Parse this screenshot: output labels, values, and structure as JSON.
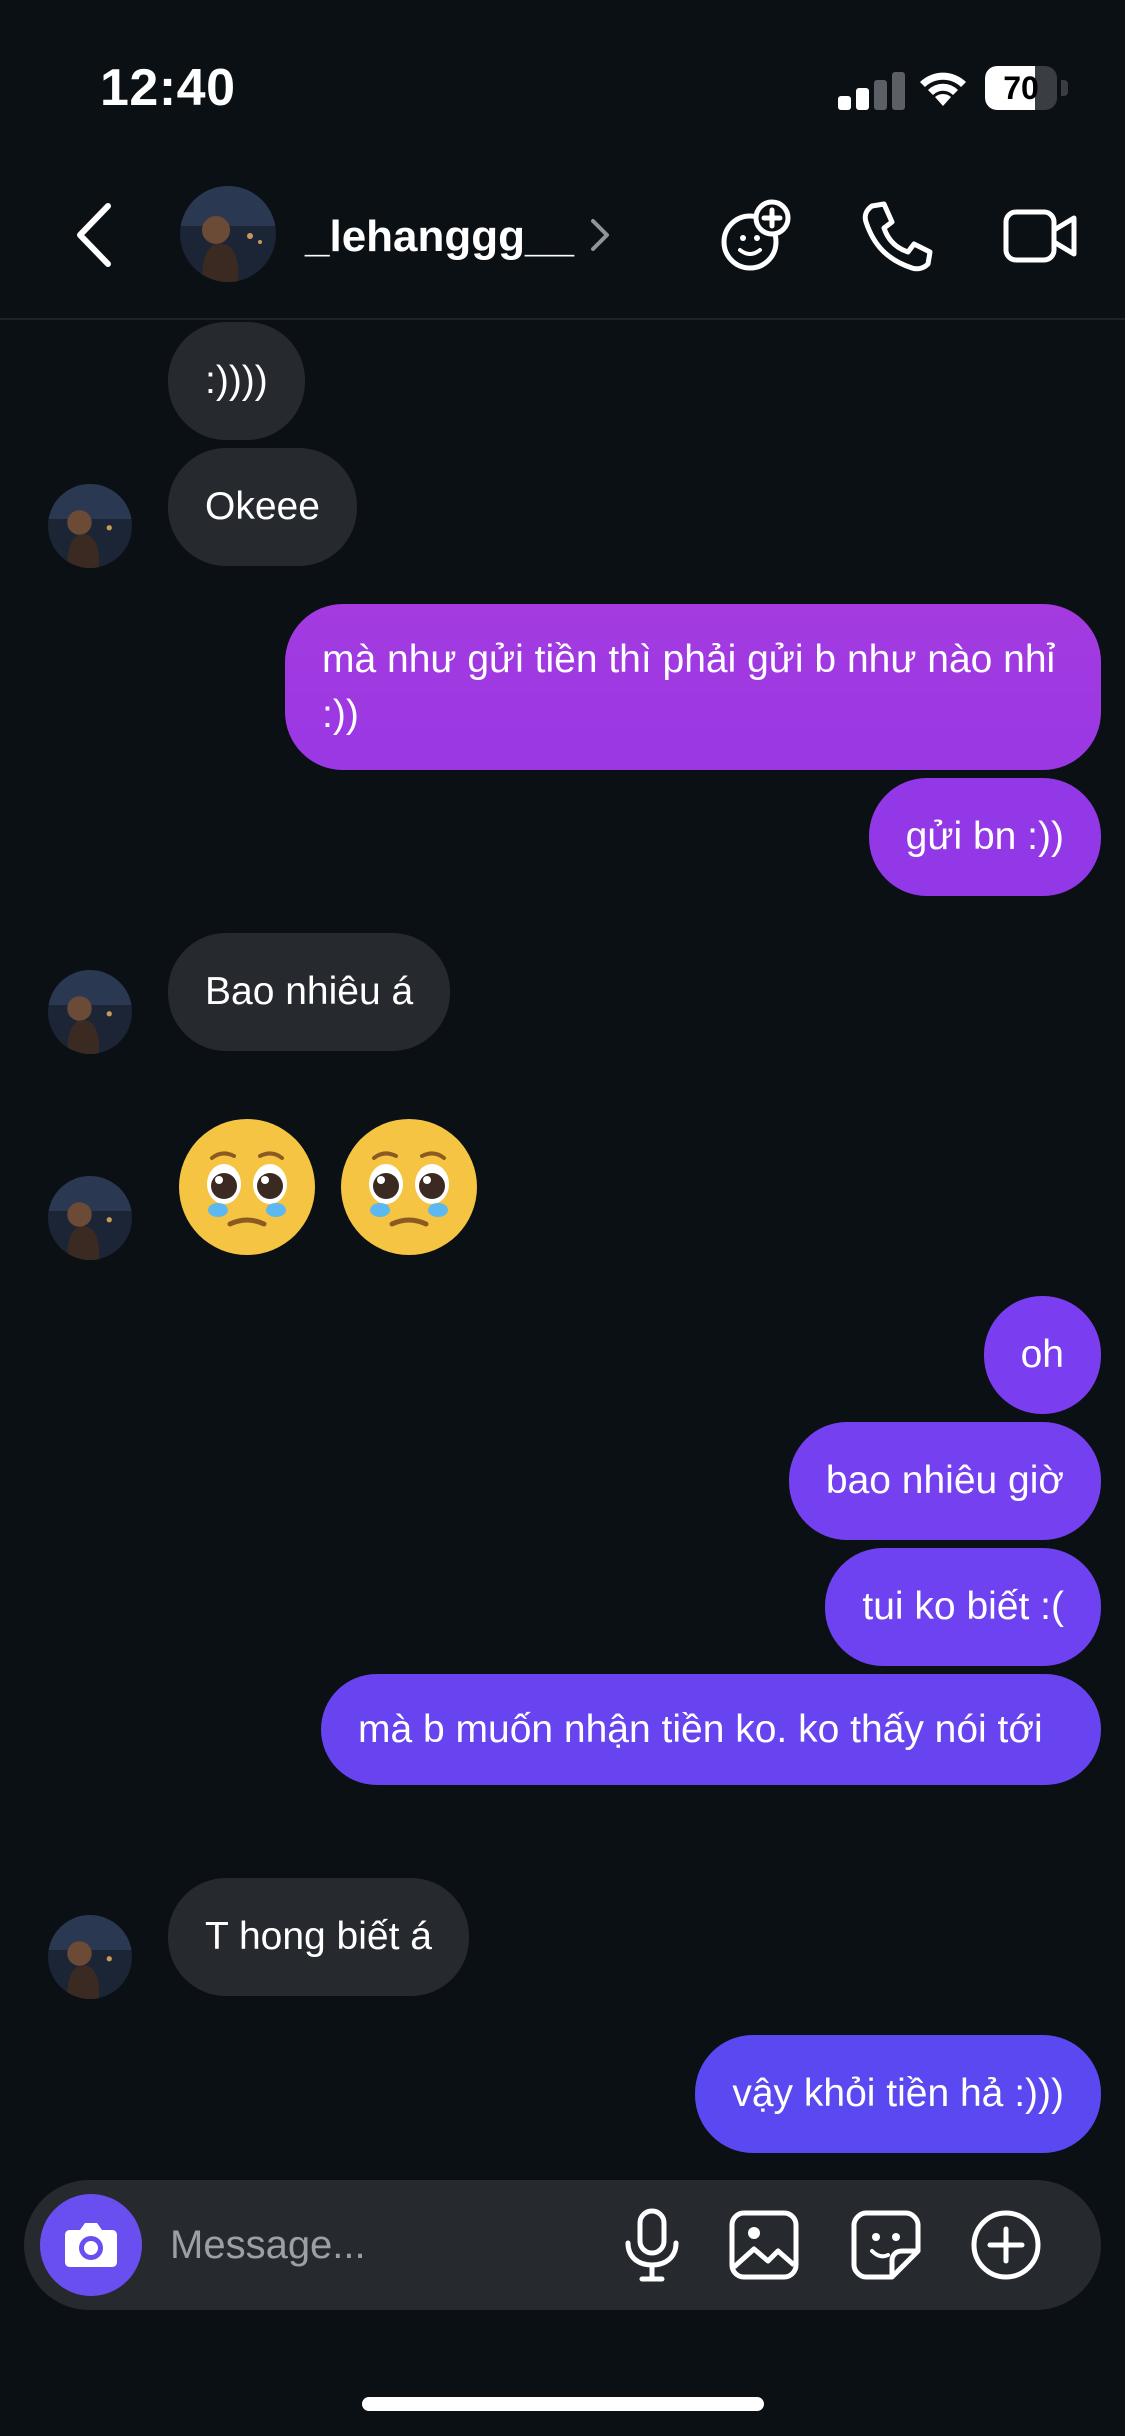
{
  "status_bar": {
    "time": "12:40",
    "battery_level": "70",
    "battery_fraction": 0.7
  },
  "header": {
    "username": "_lehanggg__",
    "icons": [
      "back-icon",
      "avatar",
      "chevron-right-icon",
      "effects-icon",
      "phone-icon",
      "video-camera-icon"
    ]
  },
  "messages": [
    {
      "side": "received",
      "text": ":))))"
    },
    {
      "side": "received",
      "text": "Okeee"
    },
    {
      "side": "sent",
      "text": "mà như gửi tiền thì phải gửi b như nào nhỉ :))"
    },
    {
      "side": "sent",
      "text": "gửi bn :))"
    },
    {
      "side": "received",
      "text": "Bao nhiêu á"
    },
    {
      "side": "received",
      "text": "🥹🥹",
      "emoji": "pleading-face-with-tears"
    },
    {
      "side": "sent",
      "text": "oh"
    },
    {
      "side": "sent",
      "text": "bao nhiêu giờ"
    },
    {
      "side": "sent",
      "text": "tui ko biết :("
    },
    {
      "side": "sent",
      "text": "mà b muốn nhận tiền ko. ko thấy nói tới"
    },
    {
      "side": "received",
      "text": "T hong biết á"
    },
    {
      "side": "sent",
      "text": "vậy khỏi tiền hả :)))"
    }
  ],
  "composer": {
    "placeholder": "Message...",
    "icons": [
      "camera-icon",
      "microphone-icon",
      "gallery-icon",
      "sticker-icon",
      "plus-icon"
    ]
  },
  "colors": {
    "background": "#0b1015",
    "received_bubble": "#262a2f",
    "sent_gradient_top": "#a434e0",
    "sent_gradient_bottom": "#5a46f0",
    "camera_button": "#6a4ff0"
  }
}
